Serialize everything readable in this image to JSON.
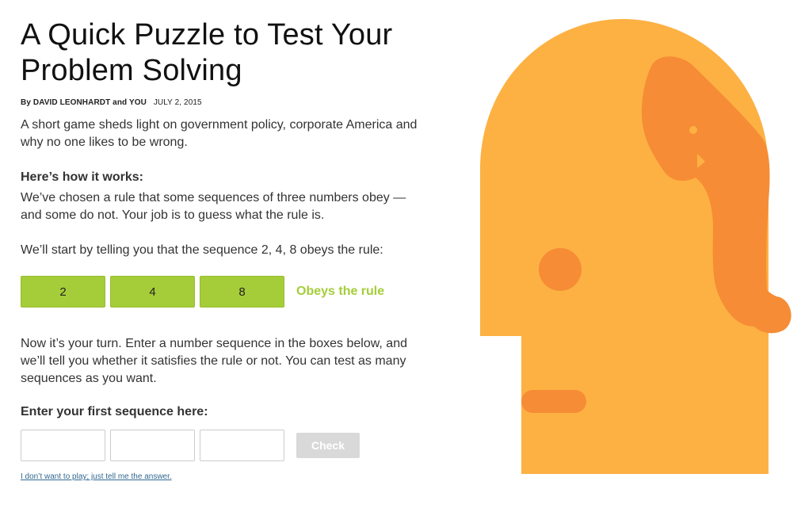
{
  "article": {
    "headline": "A Quick Puzzle to Test Your Problem Solving",
    "byline": {
      "by": "By",
      "authors": "DAVID LEONHARDT and YOU",
      "date": "JULY 2, 2015"
    },
    "summary": "A short game sheds light on government policy, corporate America and why no one likes to be wrong.",
    "how_heading": "Here’s how it works:",
    "how_body": "We’ve chosen a rule that some sequences of three numbers obey — and some do not. Your job is to guess what the rule is.",
    "start_line": "We’ll start by telling you that the sequence 2, 4, 8 obeys the rule:",
    "example_sequence": [
      "2",
      "4",
      "8"
    ],
    "example_result": "Obeys the rule",
    "turn_text": "Now it’s your turn. Enter a number sequence in the boxes below, and we’ll tell you whether it satisfies the rule or not. You can test as many sequences as you want.",
    "enter_heading": "Enter your first sequence here:",
    "inputs": [
      "",
      "",
      ""
    ],
    "check_label": "Check",
    "answer_link": "I don’t want to play; just tell me the answer."
  },
  "colors": {
    "accent_green": "#a5cd39",
    "head_yellow": "#fdb143",
    "head_orange": "#f68c35",
    "link_blue": "#326891"
  },
  "illustration": {
    "icon": "head-illustration"
  }
}
